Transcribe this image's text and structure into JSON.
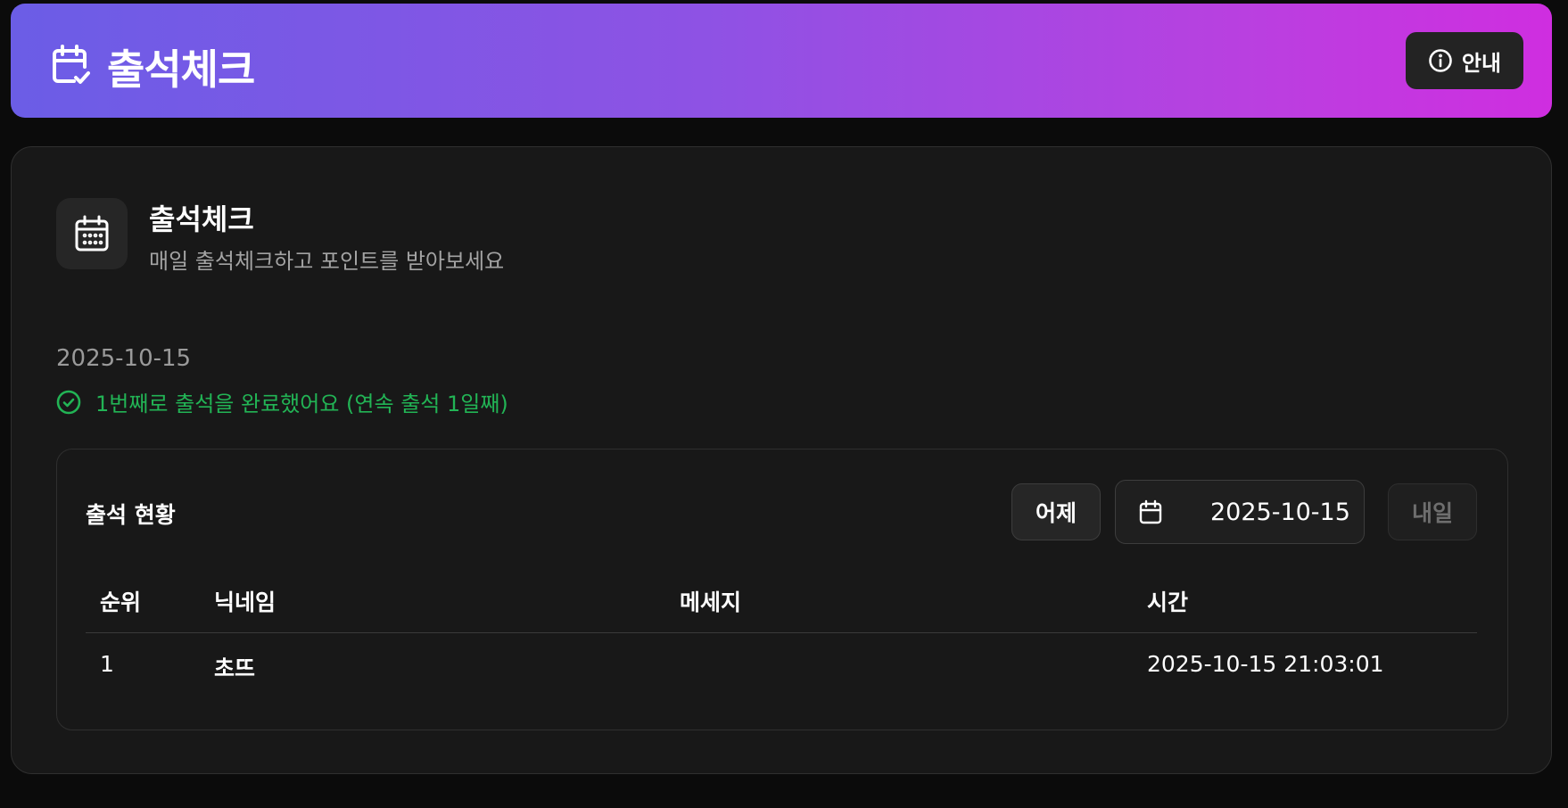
{
  "header": {
    "title": "출석체크",
    "guide_button_label": "안내",
    "gradient_start": "#6b5de6",
    "gradient_end": "#cf2ee0"
  },
  "card": {
    "title": "출석체크",
    "subtitle": "매일 출석체크하고 포인트를 받아보세요",
    "icon": "calendar-icon"
  },
  "today": {
    "date": "2025-10-15",
    "status_message": "1번째로 출석을 완료했어요 (연속 출석 1일째)",
    "status_color": "#22b455"
  },
  "attendance": {
    "panel_title": "출석 현황",
    "prev_label": "어제",
    "next_label": "내일",
    "selected_date": "2025-10-15",
    "columns": [
      "순위",
      "닉네임",
      "메세지",
      "시간"
    ],
    "rows": [
      {
        "rank": "1",
        "nickname": "초뜨",
        "message": "",
        "time": "2025-10-15 21:03:01"
      }
    ]
  }
}
